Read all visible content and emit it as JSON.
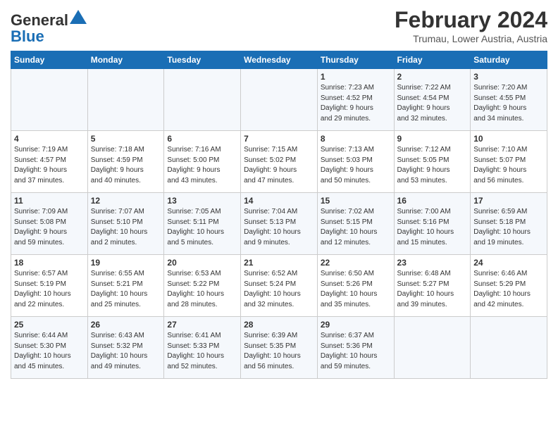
{
  "logo": {
    "text_general": "General",
    "text_blue": "Blue"
  },
  "title": "February 2024",
  "subtitle": "Trumau, Lower Austria, Austria",
  "days_of_week": [
    "Sunday",
    "Monday",
    "Tuesday",
    "Wednesday",
    "Thursday",
    "Friday",
    "Saturday"
  ],
  "weeks": [
    [
      {
        "day": "",
        "info": ""
      },
      {
        "day": "",
        "info": ""
      },
      {
        "day": "",
        "info": ""
      },
      {
        "day": "",
        "info": ""
      },
      {
        "day": "1",
        "info": "Sunrise: 7:23 AM\nSunset: 4:52 PM\nDaylight: 9 hours\nand 29 minutes."
      },
      {
        "day": "2",
        "info": "Sunrise: 7:22 AM\nSunset: 4:54 PM\nDaylight: 9 hours\nand 32 minutes."
      },
      {
        "day": "3",
        "info": "Sunrise: 7:20 AM\nSunset: 4:55 PM\nDaylight: 9 hours\nand 34 minutes."
      }
    ],
    [
      {
        "day": "4",
        "info": "Sunrise: 7:19 AM\nSunset: 4:57 PM\nDaylight: 9 hours\nand 37 minutes."
      },
      {
        "day": "5",
        "info": "Sunrise: 7:18 AM\nSunset: 4:59 PM\nDaylight: 9 hours\nand 40 minutes."
      },
      {
        "day": "6",
        "info": "Sunrise: 7:16 AM\nSunset: 5:00 PM\nDaylight: 9 hours\nand 43 minutes."
      },
      {
        "day": "7",
        "info": "Sunrise: 7:15 AM\nSunset: 5:02 PM\nDaylight: 9 hours\nand 47 minutes."
      },
      {
        "day": "8",
        "info": "Sunrise: 7:13 AM\nSunset: 5:03 PM\nDaylight: 9 hours\nand 50 minutes."
      },
      {
        "day": "9",
        "info": "Sunrise: 7:12 AM\nSunset: 5:05 PM\nDaylight: 9 hours\nand 53 minutes."
      },
      {
        "day": "10",
        "info": "Sunrise: 7:10 AM\nSunset: 5:07 PM\nDaylight: 9 hours\nand 56 minutes."
      }
    ],
    [
      {
        "day": "11",
        "info": "Sunrise: 7:09 AM\nSunset: 5:08 PM\nDaylight: 9 hours\nand 59 minutes."
      },
      {
        "day": "12",
        "info": "Sunrise: 7:07 AM\nSunset: 5:10 PM\nDaylight: 10 hours\nand 2 minutes."
      },
      {
        "day": "13",
        "info": "Sunrise: 7:05 AM\nSunset: 5:11 PM\nDaylight: 10 hours\nand 5 minutes."
      },
      {
        "day": "14",
        "info": "Sunrise: 7:04 AM\nSunset: 5:13 PM\nDaylight: 10 hours\nand 9 minutes."
      },
      {
        "day": "15",
        "info": "Sunrise: 7:02 AM\nSunset: 5:15 PM\nDaylight: 10 hours\nand 12 minutes."
      },
      {
        "day": "16",
        "info": "Sunrise: 7:00 AM\nSunset: 5:16 PM\nDaylight: 10 hours\nand 15 minutes."
      },
      {
        "day": "17",
        "info": "Sunrise: 6:59 AM\nSunset: 5:18 PM\nDaylight: 10 hours\nand 19 minutes."
      }
    ],
    [
      {
        "day": "18",
        "info": "Sunrise: 6:57 AM\nSunset: 5:19 PM\nDaylight: 10 hours\nand 22 minutes."
      },
      {
        "day": "19",
        "info": "Sunrise: 6:55 AM\nSunset: 5:21 PM\nDaylight: 10 hours\nand 25 minutes."
      },
      {
        "day": "20",
        "info": "Sunrise: 6:53 AM\nSunset: 5:22 PM\nDaylight: 10 hours\nand 28 minutes."
      },
      {
        "day": "21",
        "info": "Sunrise: 6:52 AM\nSunset: 5:24 PM\nDaylight: 10 hours\nand 32 minutes."
      },
      {
        "day": "22",
        "info": "Sunrise: 6:50 AM\nSunset: 5:26 PM\nDaylight: 10 hours\nand 35 minutes."
      },
      {
        "day": "23",
        "info": "Sunrise: 6:48 AM\nSunset: 5:27 PM\nDaylight: 10 hours\nand 39 minutes."
      },
      {
        "day": "24",
        "info": "Sunrise: 6:46 AM\nSunset: 5:29 PM\nDaylight: 10 hours\nand 42 minutes."
      }
    ],
    [
      {
        "day": "25",
        "info": "Sunrise: 6:44 AM\nSunset: 5:30 PM\nDaylight: 10 hours\nand 45 minutes."
      },
      {
        "day": "26",
        "info": "Sunrise: 6:43 AM\nSunset: 5:32 PM\nDaylight: 10 hours\nand 49 minutes."
      },
      {
        "day": "27",
        "info": "Sunrise: 6:41 AM\nSunset: 5:33 PM\nDaylight: 10 hours\nand 52 minutes."
      },
      {
        "day": "28",
        "info": "Sunrise: 6:39 AM\nSunset: 5:35 PM\nDaylight: 10 hours\nand 56 minutes."
      },
      {
        "day": "29",
        "info": "Sunrise: 6:37 AM\nSunset: 5:36 PM\nDaylight: 10 hours\nand 59 minutes."
      },
      {
        "day": "",
        "info": ""
      },
      {
        "day": "",
        "info": ""
      }
    ]
  ]
}
